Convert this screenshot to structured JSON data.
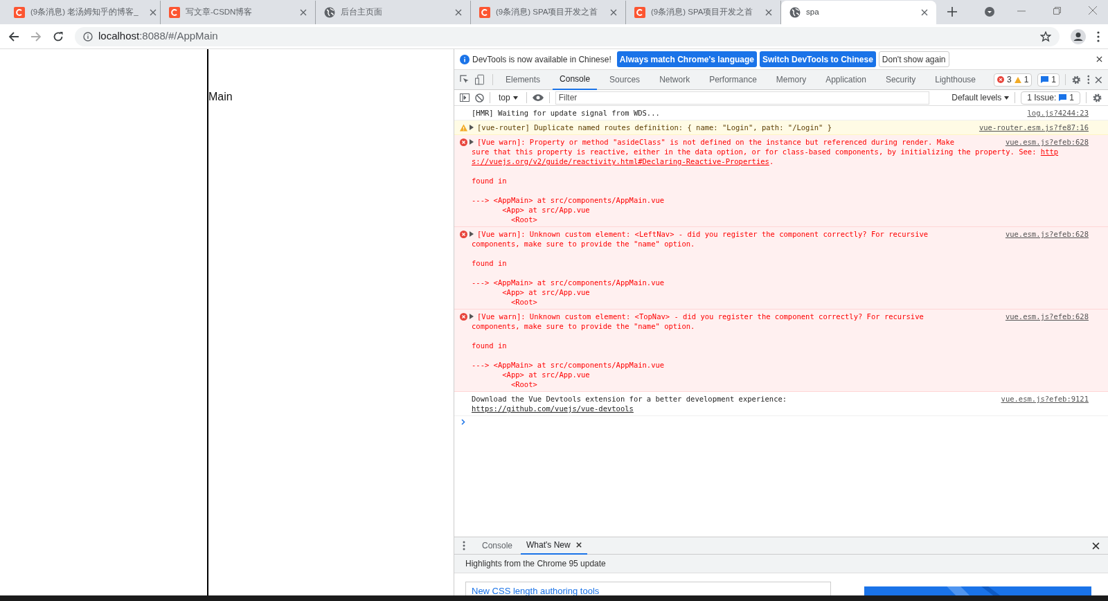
{
  "browser": {
    "tabs": [
      {
        "title": "(9条消息) 老汤姆知乎的博客_",
        "kind": "blog",
        "selected": false
      },
      {
        "title": "写文章-CSDN博客",
        "kind": "blog",
        "selected": false
      },
      {
        "title": "后台主页面",
        "kind": "page",
        "selected": false
      },
      {
        "title": "(9条消息) SPA项目开发之首",
        "kind": "blog",
        "selected": false
      },
      {
        "title": "(9条消息) SPA项目开发之首",
        "kind": "blog",
        "selected": false
      },
      {
        "title": "spa",
        "kind": "page",
        "selected": true
      }
    ],
    "address": {
      "host": "localhost",
      "rest": ":8088/#/AppMain"
    }
  },
  "page": {
    "main_text": "Main"
  },
  "devtools": {
    "infobar": {
      "message": "DevTools is now available in Chinese!",
      "buttons": [
        {
          "label": "Always match Chrome's language",
          "primary": true
        },
        {
          "label": "Switch DevTools to Chinese",
          "primary": true
        },
        {
          "label": "Don't show again",
          "primary": false
        }
      ]
    },
    "tabs": [
      {
        "label": "Elements",
        "selected": false
      },
      {
        "label": "Console",
        "selected": true
      },
      {
        "label": "Sources",
        "selected": false
      },
      {
        "label": "Network",
        "selected": false
      },
      {
        "label": "Performance",
        "selected": false
      },
      {
        "label": "Memory",
        "selected": false
      },
      {
        "label": "Application",
        "selected": false
      },
      {
        "label": "Security",
        "selected": false
      },
      {
        "label": "Lighthouse",
        "selected": false
      }
    ],
    "counters": {
      "errors": "3",
      "warnings": "1",
      "messages": "1"
    },
    "console_toolbar": {
      "context": "top",
      "filter": {
        "placeholder": "Filter"
      },
      "levels": "Default levels",
      "issues_label": "1 Issue:",
      "issues_count": "1"
    },
    "messages": [
      {
        "kind": "log",
        "expandable": false,
        "source": "log.js?4244:23",
        "paragraphs": [
          [
            {
              "text": "[HMR] Waiting for update signal from WDS..."
            }
          ]
        ]
      },
      {
        "kind": "warning",
        "expandable": true,
        "source": "vue-router.esm.js?fe87:16",
        "paragraphs": [
          [
            {
              "text": "[vue-router] Duplicate named routes definition: { name: \"Login\", path: \"/Login\" }"
            }
          ]
        ]
      },
      {
        "kind": "error",
        "expandable": true,
        "source": "vue.esm.js?efeb:628",
        "paragraphs": [
          [
            {
              "text": "[Vue warn]: Property or method \"asideClass\" is not defined on the instance but referenced during render. Make"
            },
            {
              "text": "sure that this property is reactive, either in the data option, or for class-based components, by initializing the property. See: ",
              "link": "http"
            },
            {
              "link": "s://vuejs.org/v2/guide/reactivity.html#Declaring-Reactive-Properties",
              "text_after": "."
            }
          ],
          [
            {
              "text": "found in"
            }
          ],
          [
            {
              "text": "---> <AppMain> at src/components/AppMain.vue"
            },
            {
              "text": "       <App> at src/App.vue"
            },
            {
              "text": "         <Root>"
            }
          ]
        ]
      },
      {
        "kind": "error",
        "expandable": true,
        "source": "vue.esm.js?efeb:628",
        "paragraphs": [
          [
            {
              "text": "[Vue warn]: Unknown custom element: <LeftNav> - did you register the component correctly? For recursive"
            },
            {
              "text": "components, make sure to provide the \"name\" option."
            }
          ],
          [
            {
              "text": "found in"
            }
          ],
          [
            {
              "text": "---> <AppMain> at src/components/AppMain.vue"
            },
            {
              "text": "       <App> at src/App.vue"
            },
            {
              "text": "         <Root>"
            }
          ]
        ]
      },
      {
        "kind": "error",
        "expandable": true,
        "source": "vue.esm.js?efeb:628",
        "paragraphs": [
          [
            {
              "text": "[Vue warn]: Unknown custom element: <TopNav> - did you register the component correctly? For recursive"
            },
            {
              "text": "components, make sure to provide the \"name\" option."
            }
          ],
          [
            {
              "text": "found in"
            }
          ],
          [
            {
              "text": "---> <AppMain> at src/components/AppMain.vue"
            },
            {
              "text": "       <App> at src/App.vue"
            },
            {
              "text": "         <Root>"
            }
          ]
        ]
      },
      {
        "kind": "log",
        "expandable": false,
        "source": "vue.esm.js?efeb:9121",
        "paragraphs": [
          [
            {
              "text": "Download the Vue Devtools extension for a better development experience:"
            },
            {
              "link": "https://github.com/vuejs/vue-devtools"
            }
          ]
        ]
      }
    ],
    "drawer": {
      "tabs": [
        {
          "label": "Console",
          "selected": false,
          "closable": false
        },
        {
          "label": "What's New",
          "selected": true,
          "closable": true
        }
      ],
      "highlights": "Highlights from the Chrome 95 update",
      "card_link": "New CSS length authoring tools"
    }
  }
}
